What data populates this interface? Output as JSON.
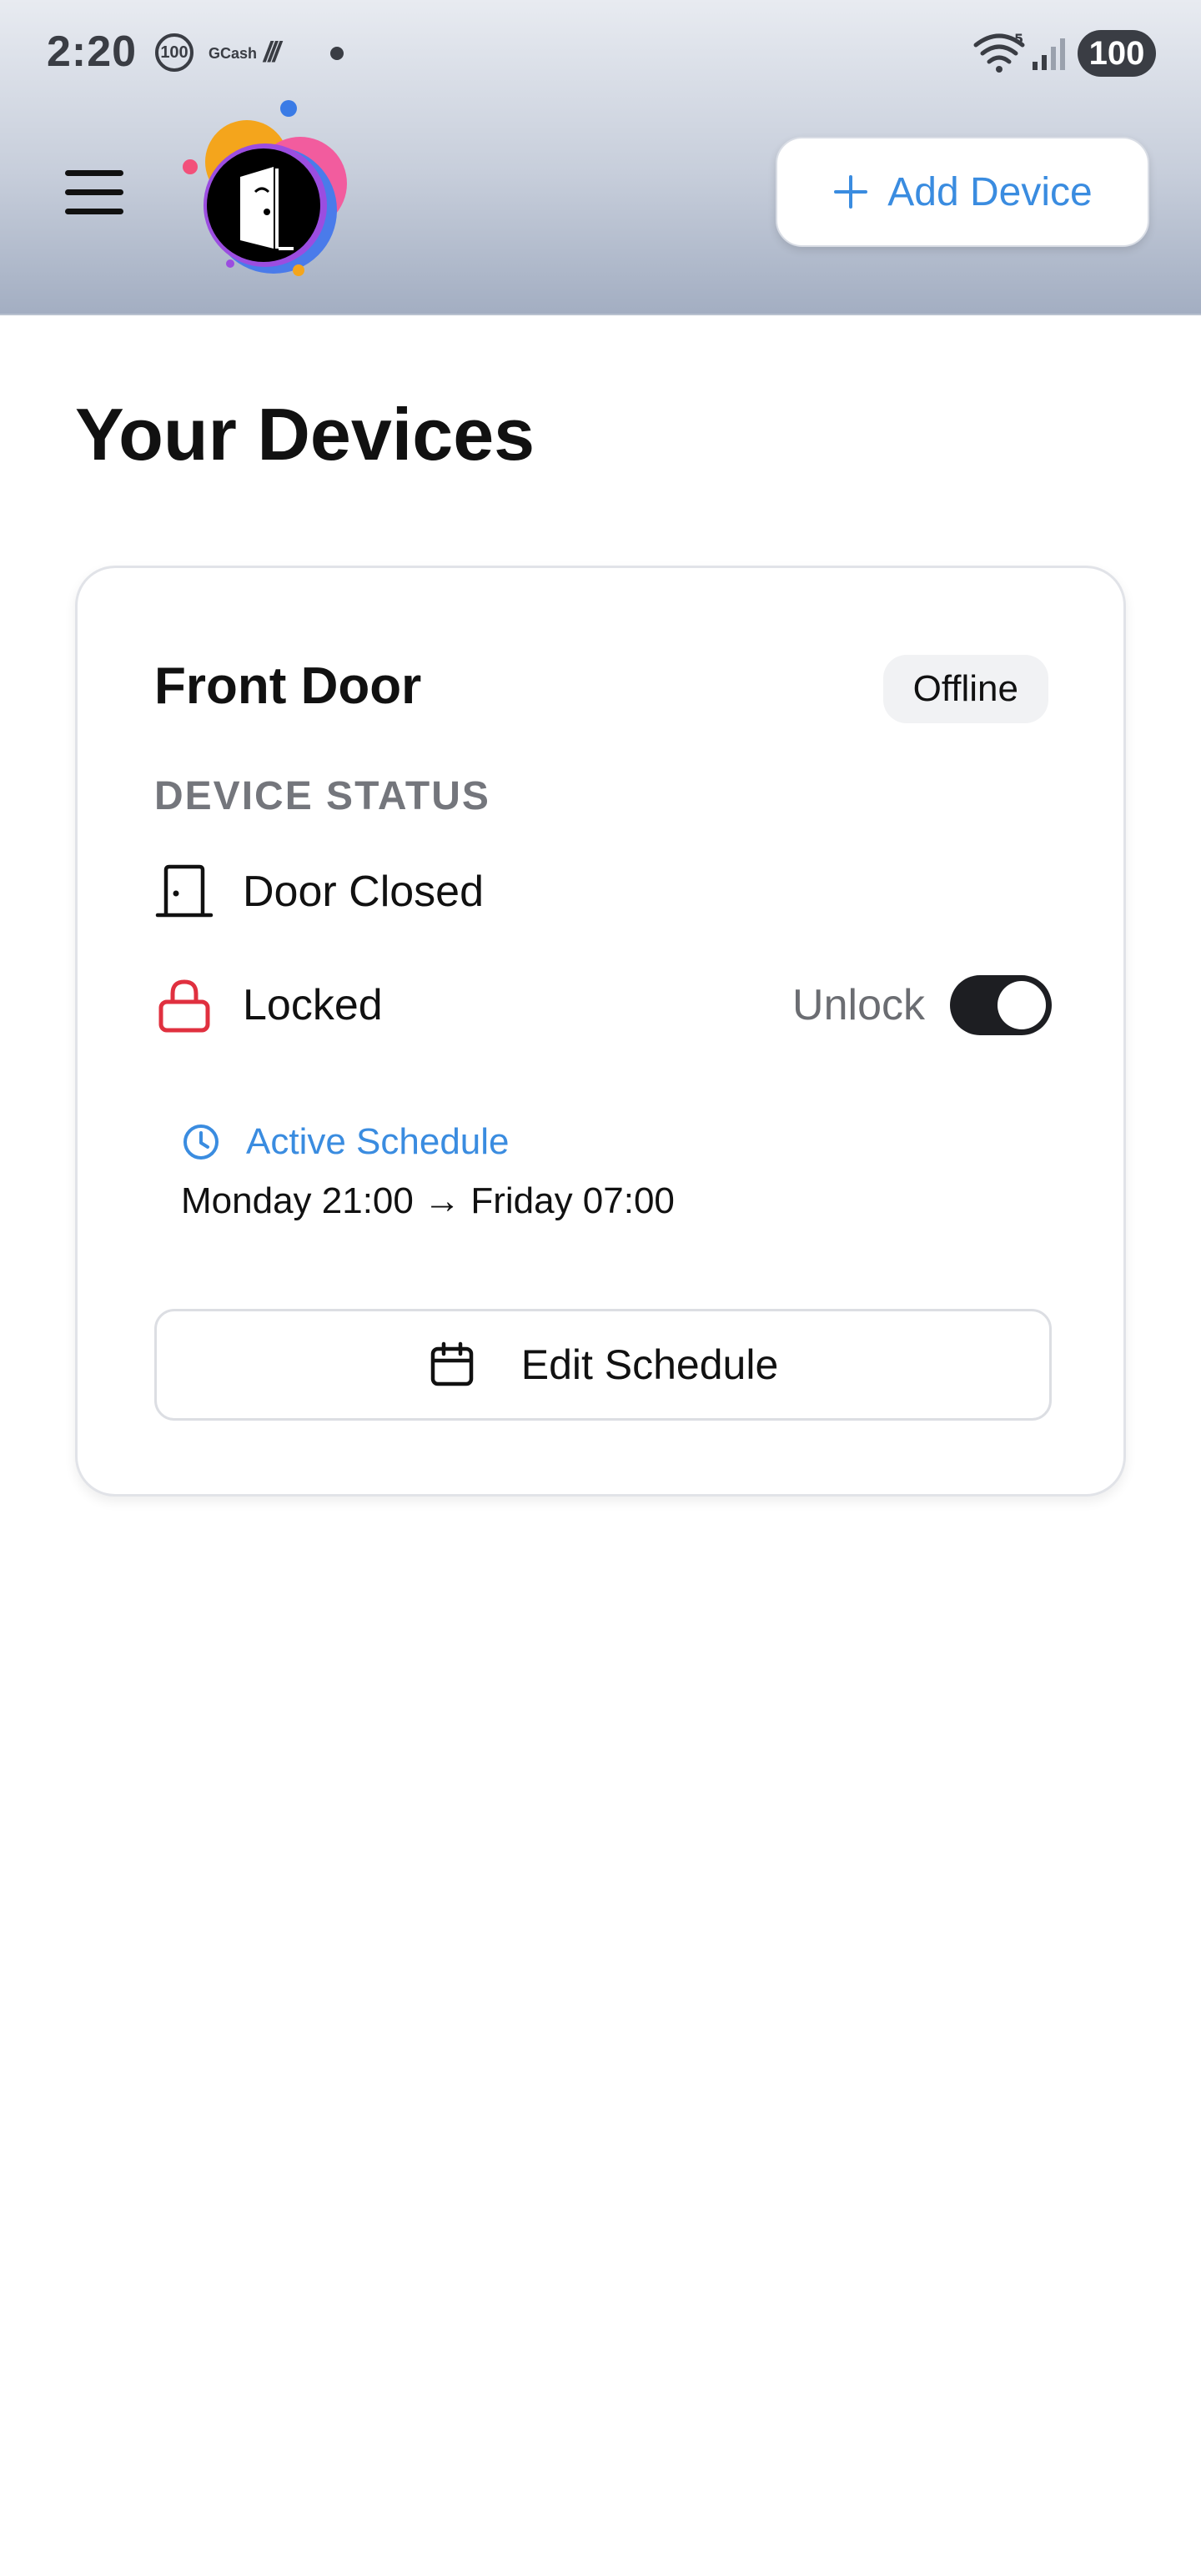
{
  "status_bar": {
    "time": "2:20",
    "circle_badge": "100",
    "app_label": "GCash",
    "slashes": "///",
    "battery": "100"
  },
  "header": {
    "menu_icon": "hamburger-menu-icon",
    "logo_icon": "smart-door-logo-icon",
    "add_device_label": "Add Device",
    "accent_color": "#3a8ce0"
  },
  "main": {
    "title": "Your Devices",
    "devices": [
      {
        "name": "Front Door",
        "connection": "Offline",
        "section_label": "DEVICE STATUS",
        "door_state": "Door Closed",
        "lock_state": "Locked",
        "lock_color": "#e0303f",
        "toggle_label": "Unlock",
        "toggle_on": true,
        "schedule": {
          "title": "Active Schedule",
          "range": "Monday 21:00 → Friday 07:00"
        },
        "edit_label": "Edit Schedule"
      }
    ]
  }
}
